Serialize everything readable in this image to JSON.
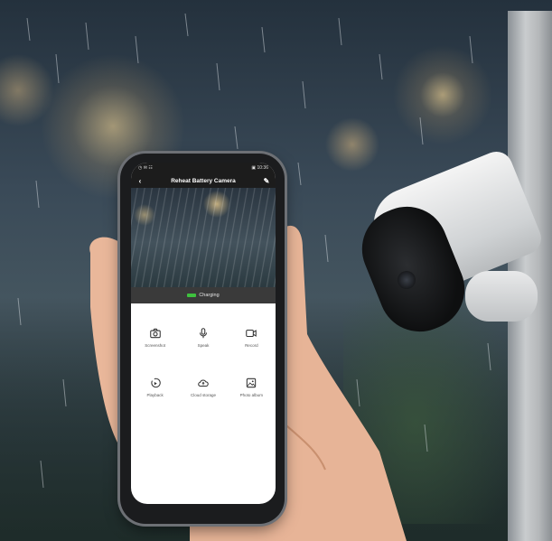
{
  "phone": {
    "status_time": "◷ ✉ ☷",
    "status_right": "▣ 10:36",
    "nav": {
      "back_icon": "chevron-left-icon",
      "title": "Reheat Battery Camera",
      "edit_icon": "pencil-icon"
    },
    "charge": {
      "label": "Charging"
    },
    "actions": [
      {
        "label": "Screenshot",
        "icon": "camera-icon"
      },
      {
        "label": "Speak",
        "icon": "microphone-icon"
      },
      {
        "label": "Record",
        "icon": "video-icon"
      },
      {
        "label": "Playback",
        "icon": "playback-icon"
      },
      {
        "label": "Cloud storage",
        "icon": "cloud-icon"
      },
      {
        "label": "Photo album",
        "icon": "image-icon"
      }
    ]
  },
  "colors": {
    "charge_indicator": "#3ec13e",
    "navbar": "#1c1c1c"
  }
}
